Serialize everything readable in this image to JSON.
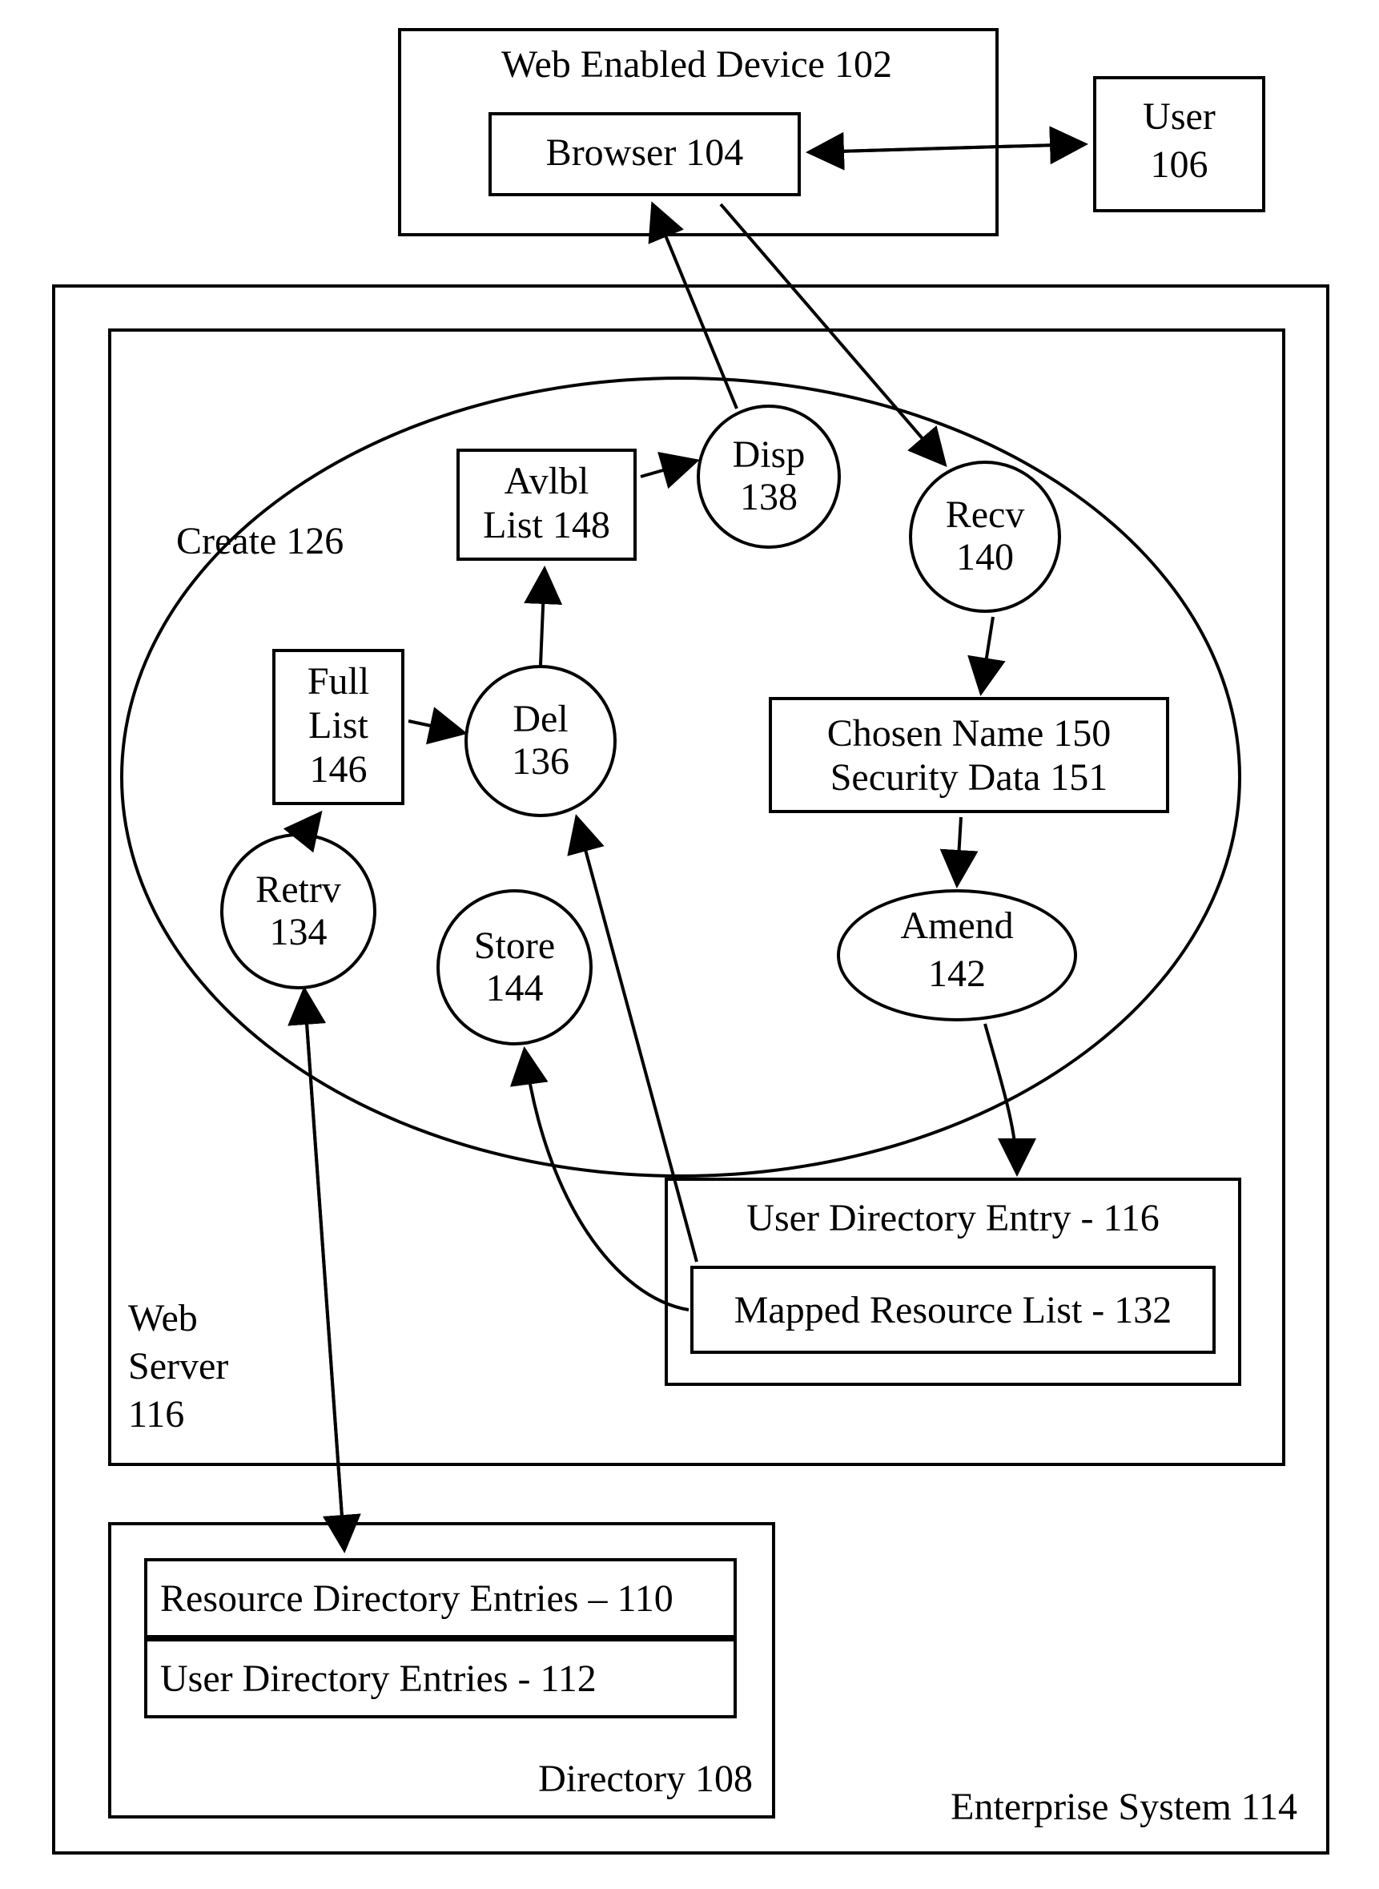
{
  "webDevice": {
    "title": "Web Enabled Device 102",
    "browser": "Browser 104"
  },
  "user": {
    "line1": "User",
    "line2": "106"
  },
  "enterprise": {
    "label": "Enterprise System 114"
  },
  "webServer": {
    "line1": "Web",
    "line2": "Server",
    "line3": "116"
  },
  "create": {
    "label": "Create 126"
  },
  "nodes": {
    "disp": {
      "line1": "Disp",
      "line2": "138"
    },
    "recv": {
      "line1": "Recv",
      "line2": "140"
    },
    "del": {
      "line1": "Del",
      "line2": "136"
    },
    "retrv": {
      "line1": "Retrv",
      "line2": "134"
    },
    "store": {
      "line1": "Store",
      "line2": "144"
    },
    "amend": {
      "line1": "Amend",
      "line2": "142"
    }
  },
  "rects": {
    "avlbl": {
      "line1": "Avlbl",
      "line2": "List 148"
    },
    "full": {
      "line1": "Full",
      "line2": "List",
      "line3": "146"
    },
    "chosen": {
      "line1": "Chosen Name 150",
      "line2": "Security Data 151"
    }
  },
  "userDir": {
    "title": "User Directory Entry - 116",
    "mapped": "Mapped Resource List - 132"
  },
  "directory": {
    "title": "Directory 108",
    "resEntries": "Resource Directory Entries – 110",
    "userEntries": "User Directory Entries - 112"
  }
}
